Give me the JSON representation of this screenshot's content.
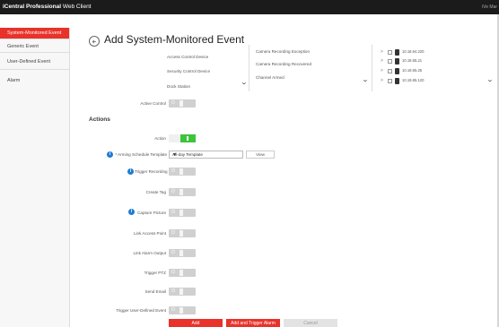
{
  "app": {
    "title_bold": "iCentral Professional",
    "title_rest": " Web Client",
    "top_right": "iVe Mar"
  },
  "sidebar": {
    "items": [
      {
        "label": "System-Monitored Event",
        "active": true
      },
      {
        "label": "Generic Event",
        "active": false
      },
      {
        "label": "User-Defined Event",
        "active": false
      },
      {
        "label": "Alarm",
        "active": false
      }
    ]
  },
  "page": {
    "title": "Add System-Monitored Event"
  },
  "source_types": [
    "Access Control Device",
    "Security Control Device",
    "Dock Station"
  ],
  "event_types": [
    "Camera Recording Exception",
    "Camera Recording Recovered",
    "Channel Armed"
  ],
  "cameras": [
    "10.18.64.220",
    "10.18.65.21",
    "10.18.65.25",
    "10.18.65.120"
  ],
  "active_control": {
    "label": "Active Control",
    "state": "O"
  },
  "actions": {
    "title": "Actions",
    "action": {
      "label": "Action",
      "state": "I"
    },
    "arming": {
      "label": "* Arming Schedule Template",
      "value": "All-day Template",
      "view_label": "View"
    },
    "items": [
      {
        "label": "Trigger Recording",
        "info": true,
        "state": "O"
      },
      {
        "label": "Create Tag",
        "info": false,
        "state": "O"
      },
      {
        "label": "Capture Picture",
        "info": true,
        "state": "O"
      },
      {
        "label": "Link Access Point",
        "info": false,
        "state": "O"
      },
      {
        "label": "Link Alarm Output",
        "info": false,
        "state": "O"
      },
      {
        "label": "Trigger PTZ",
        "info": false,
        "state": "O"
      },
      {
        "label": "Send Email",
        "info": false,
        "state": "O"
      },
      {
        "label": "Trigger User-Defined Event",
        "info": false,
        "state": "O"
      }
    ]
  },
  "buttons": {
    "add": "Add",
    "add_continue": "Add and Trigger Alarm",
    "cancel": "Cancel"
  },
  "colors": {
    "accent": "#e8322a",
    "toggle_on": "#3cc43c",
    "info": "#1f7ccf"
  }
}
